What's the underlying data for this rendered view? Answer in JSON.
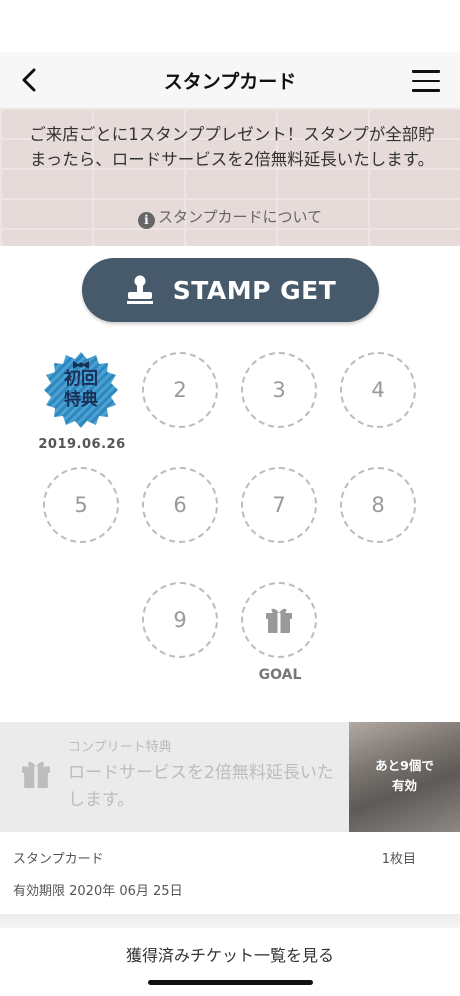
{
  "header": {
    "title": "スタンプカード"
  },
  "banner": {
    "message": "ご来店ごとに1スタンププレゼント！スタンプが全部貯まったら、ロードサービスを2倍無料延長いたします。",
    "about_link": "スタンプカードについて"
  },
  "stamp_button": {
    "label": "STAMP GET"
  },
  "stamps": {
    "first": {
      "line1": "初回",
      "line2": "特典",
      "date": "2019.06.26"
    },
    "slots": [
      "2",
      "3",
      "4",
      "5",
      "6",
      "7",
      "8",
      "9"
    ],
    "goal_label": "GOAL"
  },
  "complete": {
    "caption": "コンプリート特典",
    "text": "ロードサービスを2倍無料延長いたします。",
    "remaining_line1": "あと9個で",
    "remaining_line2": "有効"
  },
  "card": {
    "label": "スタンプカード",
    "count": "1枚目",
    "expiry": "有効期限 2020年 06月 25日"
  },
  "history": {
    "text": "獲得済みチケット一覧を見る"
  },
  "colors": {
    "button": "#475a6b",
    "stamp_blue": "#4a9fd0"
  }
}
